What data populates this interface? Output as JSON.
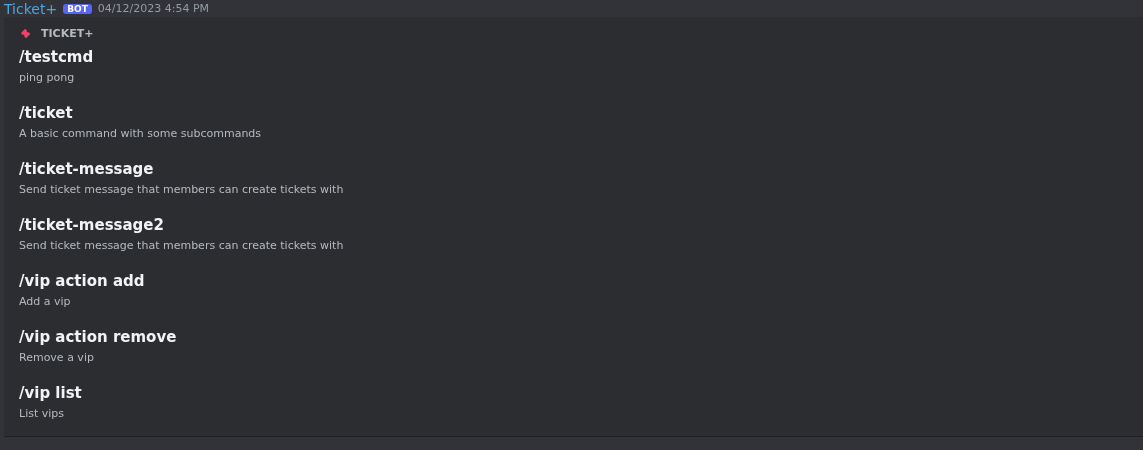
{
  "message": {
    "author": "Ticket+",
    "badge": "BOT",
    "timestamp": "04/12/2023 4:54 PM"
  },
  "popup": {
    "app_name": "TICKET+",
    "commands": [
      {
        "name": "/testcmd",
        "description": "ping pong"
      },
      {
        "name": "/ticket",
        "description": "A basic command with some subcommands"
      },
      {
        "name": "/ticket-message",
        "description": "Send ticket message that members can create tickets with"
      },
      {
        "name": "/ticket-message2",
        "description": "Send ticket message that members can create tickets with"
      },
      {
        "name": "/vip action add",
        "description": "Add a vip"
      },
      {
        "name": "/vip action remove",
        "description": "Remove a vip"
      },
      {
        "name": "/vip list",
        "description": "List vips"
      }
    ]
  }
}
